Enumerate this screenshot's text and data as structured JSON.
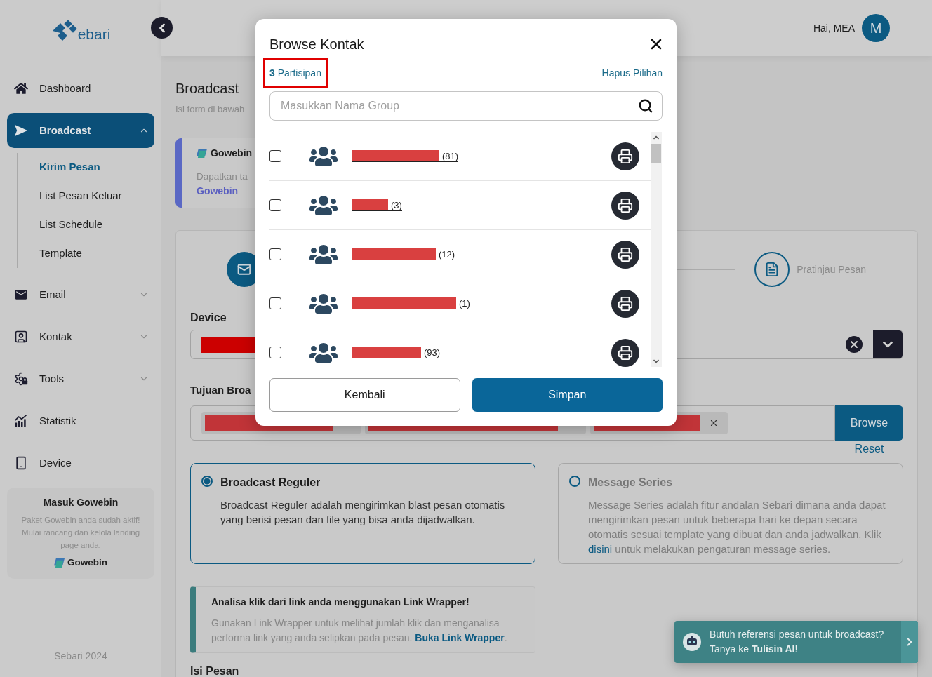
{
  "sidebar": {
    "logo_text": "ebari",
    "nav": [
      {
        "label": "Dashboard",
        "kind": "link",
        "selected": false
      },
      {
        "label": "Broadcast",
        "kind": "group",
        "selected": true,
        "expanded": true,
        "children": [
          {
            "label": "Kirim Pesan",
            "selected": true
          },
          {
            "label": "List Pesan Keluar",
            "selected": false
          },
          {
            "label": "List Schedule",
            "selected": false
          },
          {
            "label": "Template",
            "selected": false
          }
        ]
      },
      {
        "label": "Email",
        "kind": "group",
        "selected": false,
        "expanded": false
      },
      {
        "label": "Kontak",
        "kind": "group",
        "selected": false,
        "expanded": false
      },
      {
        "label": "Tools",
        "kind": "group",
        "selected": false,
        "expanded": false
      },
      {
        "label": "Statistik",
        "kind": "link",
        "selected": false
      },
      {
        "label": "Device",
        "kind": "link",
        "selected": false
      }
    ],
    "promo": {
      "title": "Masuk Gowebin",
      "text": "Paket Gowebin anda sudah aktif! Mulai rancang dan kelola landing page anda.",
      "brand": "Gowebin"
    },
    "footer": "Sebari 2024"
  },
  "header": {
    "greeting": "Hai, MEA",
    "avatar_initial": "M"
  },
  "page": {
    "title": "Broadcast",
    "subtitle": "Isi form di bawah",
    "banner": {
      "brand": "Gowebin",
      "text": "Dapatkan ta",
      "link": "Gowebin"
    },
    "steps": [
      {
        "active": true
      },
      {
        "label": "Pratinjau Pesan",
        "active": false
      }
    ],
    "device": {
      "label": "Device",
      "redacted": true
    },
    "recipients": {
      "label": "Tujuan Broa",
      "chips": [
        {
          "redacted": true
        },
        {
          "redacted": true
        },
        {
          "redacted": true
        }
      ],
      "browse_button": "Browse",
      "reset_link": "Reset"
    },
    "broadcast_types": [
      {
        "title": "Broadcast Reguler",
        "description": "Broadcast Reguler adalah mengirimkan blast pesan otomatis yang berisi pesan dan file yang bisa anda dijadwalkan.",
        "selected": true
      },
      {
        "title": "Message Series",
        "description": "Message Series adalah fitur andalan Sebari dimana anda dapat mengirimkan pesan untuk beberapa hari ke depan secara otomatis sesuai template yang dibuat dan anda jadwalkan. Klik",
        "link": "disini",
        "description_after": "untuk melakukan pengaturan message series.",
        "selected": false
      }
    ],
    "tip": {
      "title": "Analisa klik dari link anda menggunakan Link Wrapper!",
      "text": "Gunakan Link Wrapper untuk melihat jumlah klik dan menganalisa performa link yang anda selipkan pada pesan.",
      "link": "Buka Link Wrapper",
      "text_after": "."
    },
    "message_section": "Isi Pesan"
  },
  "assistant_toast": {
    "text": "Butuh referensi pesan untuk broadcast? Tanya ke **Tulisin AI**!"
  },
  "modal": {
    "title": "Browse Kontak",
    "selected_count": "**3** Partisipan",
    "highlighted": true,
    "clear_link": "Hapus Pilihan",
    "search": {
      "placeholder": "Masukkan Nama Group"
    },
    "groups": [
      {
        "redacted": true,
        "count": "(81)",
        "checked": false
      },
      {
        "redacted": true,
        "count": "(3)",
        "checked": false
      },
      {
        "redacted": true,
        "count": "(12)",
        "checked": false
      },
      {
        "redacted": true,
        "count": "(1)",
        "checked": false
      },
      {
        "redacted": true,
        "count": "(93)",
        "checked": false
      }
    ],
    "cancel_button": "Kembali",
    "save_button": "Simpan"
  }
}
